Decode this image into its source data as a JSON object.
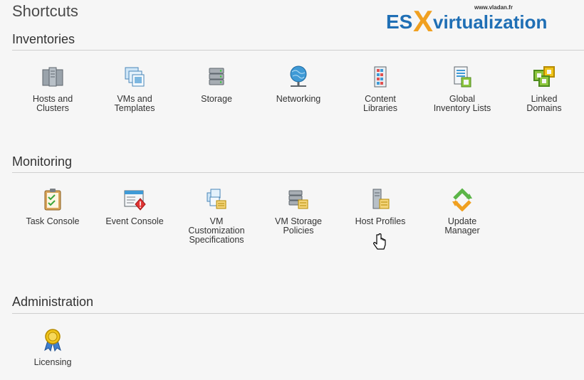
{
  "page_title": "Shortcuts",
  "logo": {
    "es": "ES",
    "x": "X",
    "text": "virtualization",
    "url": "www.vladan.fr"
  },
  "sections": {
    "inventories": {
      "title": "Inventories",
      "items": [
        {
          "label": "Hosts and\nClusters",
          "icon": "hosts-clusters-icon"
        },
        {
          "label": "VMs and\nTemplates",
          "icon": "vms-templates-icon"
        },
        {
          "label": "Storage",
          "icon": "storage-icon"
        },
        {
          "label": "Networking",
          "icon": "networking-icon"
        },
        {
          "label": "Content\nLibraries",
          "icon": "content-libraries-icon"
        },
        {
          "label": "Global\nInventory Lists",
          "icon": "global-inventory-icon"
        },
        {
          "label": "Linked\nDomains",
          "icon": "linked-domains-icon"
        }
      ]
    },
    "monitoring": {
      "title": "Monitoring",
      "items": [
        {
          "label": "Task Console",
          "icon": "task-console-icon"
        },
        {
          "label": "Event Console",
          "icon": "event-console-icon"
        },
        {
          "label": "VM\nCustomization\nSpecifications",
          "icon": "vm-customization-icon"
        },
        {
          "label": "VM Storage\nPolicies",
          "icon": "vm-storage-policies-icon"
        },
        {
          "label": "Host Profiles",
          "icon": "host-profiles-icon"
        },
        {
          "label": "Update\nManager",
          "icon": "update-manager-icon"
        }
      ]
    },
    "administration": {
      "title": "Administration",
      "items": [
        {
          "label": "Licensing",
          "icon": "licensing-icon"
        }
      ]
    }
  },
  "colors": {
    "brand_blue": "#1f6fb5",
    "brand_orange": "#f0a020",
    "section_rule": "#cfcfcf",
    "background": "#f6f6f6"
  }
}
